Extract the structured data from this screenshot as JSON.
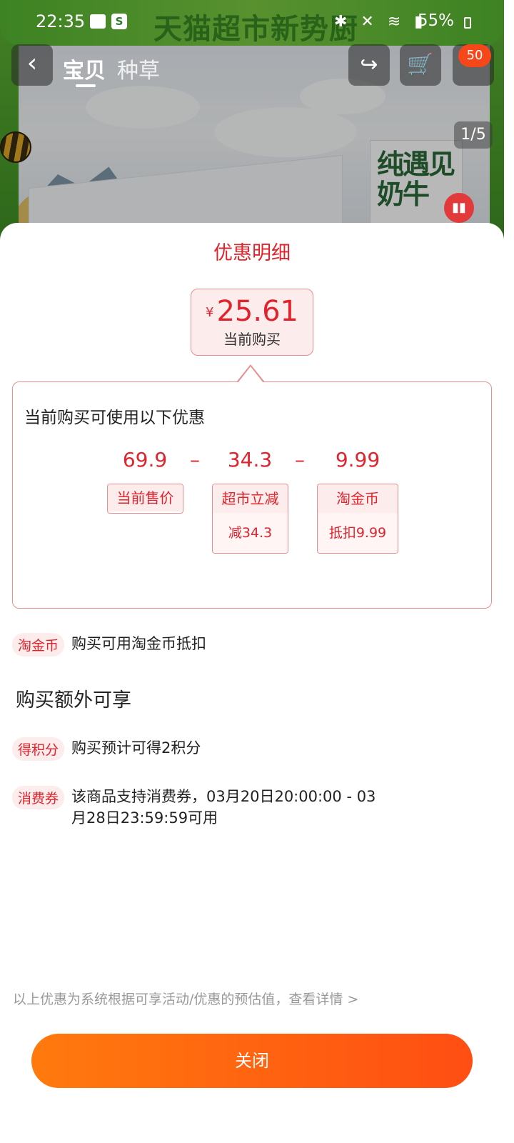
{
  "status_bar": {
    "time": "22:35",
    "battery": "55%"
  },
  "background": {
    "banner_text": "天猫超市新势厨",
    "tabs": [
      "宝贝",
      "种草"
    ],
    "cart_badge": "50",
    "image_counter": "1/5"
  },
  "sheet": {
    "title": "优惠明细",
    "current_price": {
      "currency": "¥",
      "value": "25.61",
      "caption": "当前购买"
    },
    "detail_heading": "当前购买可使用以下优惠",
    "calc": {
      "original_price": "69.9",
      "minus1": "–",
      "discount": "34.3",
      "minus2": "–",
      "coin": "9.99"
    },
    "tags": {
      "original_label": "当前售价",
      "discount_label": "超市立减",
      "discount_sub": "减34.3",
      "coin_label": "淘金币",
      "coin_sub": "抵扣9.99"
    },
    "coin_row": {
      "pill": "淘金币",
      "text": "购买可用淘金币抵扣"
    },
    "extra_heading": "购买额外可享",
    "points_row": {
      "pill": "得积分",
      "text": "购买预计可得2积分"
    },
    "voucher_row": {
      "pill": "消费券",
      "text_line1": "该商品支持消费券，03月20日20:00:00 - 03",
      "text_line2": "月28日23:59:59可用"
    },
    "disclaimer": "以上优惠为系统根据可享活动/优惠的预估值，查看详情 >",
    "close_label": "关闭"
  }
}
